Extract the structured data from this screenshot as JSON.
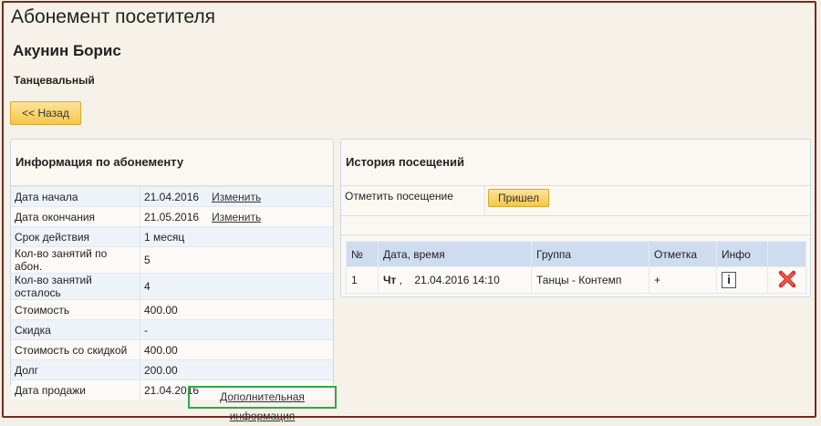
{
  "page": {
    "title": "Абонемент посетителя",
    "person_name": "Акунин Борис",
    "club_name": "Танцевальный"
  },
  "back_button": {
    "label": "<< Назад"
  },
  "subscription": {
    "heading": "Информация по абонементу",
    "change_label": "Изменить",
    "rows": [
      {
        "label": "Дата начала",
        "value": "21.04.2016"
      },
      {
        "label": "Дата окончания",
        "value": "21.05.2016"
      },
      {
        "label": "Срок действия",
        "value": "1 месяц"
      },
      {
        "label": "Кол-во занятий по абон.",
        "value": "5"
      },
      {
        "label": "Кол-во занятий осталось",
        "value": "4"
      },
      {
        "label": "Стоимость",
        "value": "400.00"
      },
      {
        "label": "Скидка",
        "value": "-"
      },
      {
        "label": "Стоимость со скидкой",
        "value": "400.00"
      },
      {
        "label": "Долг",
        "value": "200.00"
      },
      {
        "label": "Дата продажи",
        "value": "21.04.2016"
      }
    ],
    "more_info_link": "Дополнительная информация"
  },
  "history": {
    "heading": "История посещений",
    "mark_label": "Отметить посещение",
    "came_button": "Пришел",
    "columns": [
      "№",
      "Дата, время",
      "Группа",
      "Отметка",
      "Инфо"
    ],
    "rows": [
      {
        "num": "1",
        "day": "Чт",
        "sep": ",",
        "datetime": "21.04.2016 14:10",
        "group": "Танцы - Контемп",
        "mark": "+",
        "info": "i"
      }
    ]
  },
  "colors": {
    "frame": "#7a2a1a",
    "button": "#f6c64a",
    "header_bg": "#cfdcef",
    "highlight": "#2fa84a",
    "delete": "#d9322a"
  }
}
